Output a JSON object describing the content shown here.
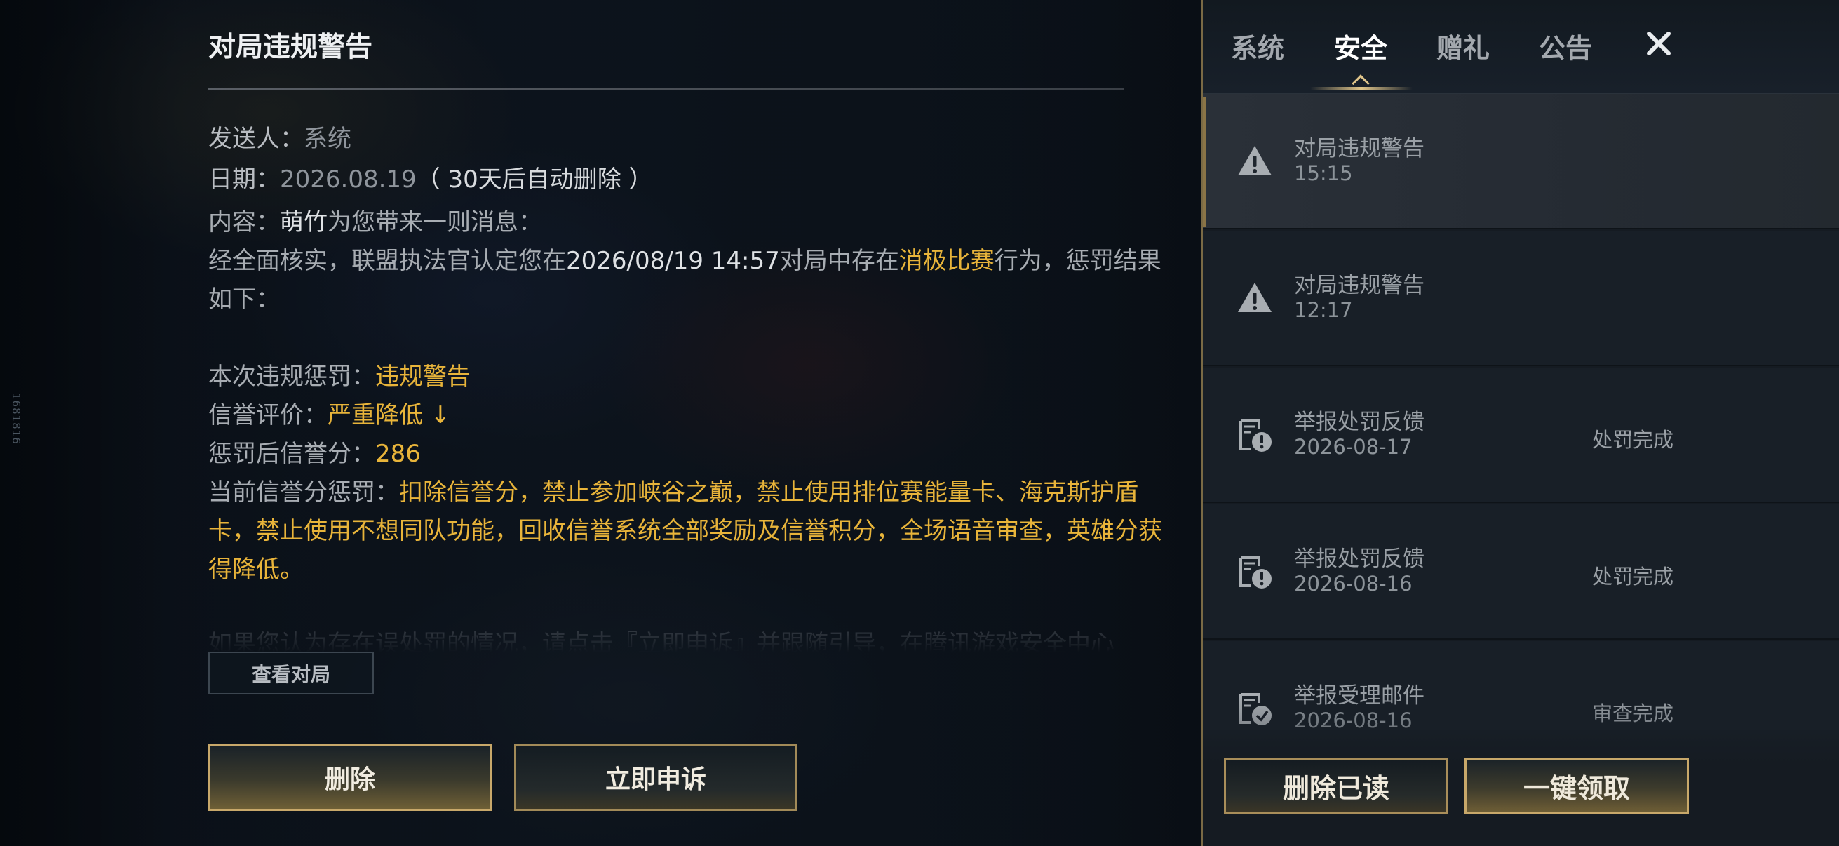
{
  "side_id": "1681816",
  "detail": {
    "title": "对局违规警告",
    "sender_label": "发送人：",
    "sender_value": "系统",
    "date_label": "日期：",
    "date_value": "2026.08.19",
    "date_note": "（ 30天后自动删除 ）",
    "content_label": "内容：",
    "content_name": "萌竹",
    "content_intro": "为您带来一则消息：",
    "body_prefix": "经全面核实，联盟执法官认定您在",
    "body_datetime": "2026/08/19 14:57",
    "body_mid": "对局中存在",
    "body_violation": "消极比赛",
    "body_suffix": "行为，惩罚结果如下：",
    "penalty_label": "本次违规惩罚：",
    "penalty_value": "违规警告",
    "reputation_label": "信誉评价：",
    "reputation_value": "严重降低 ↓",
    "score_label": "惩罚后信誉分：",
    "score_value": "286",
    "current_label": "当前信誉分惩罚：",
    "current_value": "扣除信誉分，禁止参加峡谷之巅，禁止使用排位赛能量卡、海克斯护盾卡，禁止使用不想同队功能，回收信誉系统全部奖励及信誉积分，全场语音审查，英雄分获得降低。",
    "faded_text": "如果您认为存在误处罚的情况，请点击『立即申诉』并跟随引导，在腾讯游戏安全中心",
    "view_match_label": "查看对局",
    "delete_label": "删除",
    "appeal_label": "立即申诉"
  },
  "tabs": [
    {
      "label": "系统",
      "active": false
    },
    {
      "label": "安全",
      "active": true
    },
    {
      "label": "赠礼",
      "active": false
    },
    {
      "label": "公告",
      "active": false
    }
  ],
  "close_icon": "close-icon",
  "mails": [
    {
      "icon": "warning-icon",
      "title": "对局违规警告",
      "time": "15:15",
      "status": "",
      "selected": true
    },
    {
      "icon": "warning-icon",
      "title": "对局违规警告",
      "time": "12:17",
      "status": "",
      "selected": false
    },
    {
      "icon": "report-feedback-icon",
      "title": "举报处罚反馈",
      "time": "2026-08-17",
      "status": "处罚完成",
      "selected": false
    },
    {
      "icon": "report-feedback-icon",
      "title": "举报处罚反馈",
      "time": "2026-08-16",
      "status": "处罚完成",
      "selected": false
    },
    {
      "icon": "report-accepted-icon",
      "title": "举报受理邮件",
      "time": "2026-08-16",
      "status": "审查完成",
      "selected": false
    }
  ],
  "panel_buttons": {
    "delete_read": "删除已读",
    "claim_all": "一键领取"
  },
  "colors": {
    "accent_gold": "#e8b43a",
    "border_gold": "#c8a86a",
    "panel_bg": "#151b22"
  }
}
